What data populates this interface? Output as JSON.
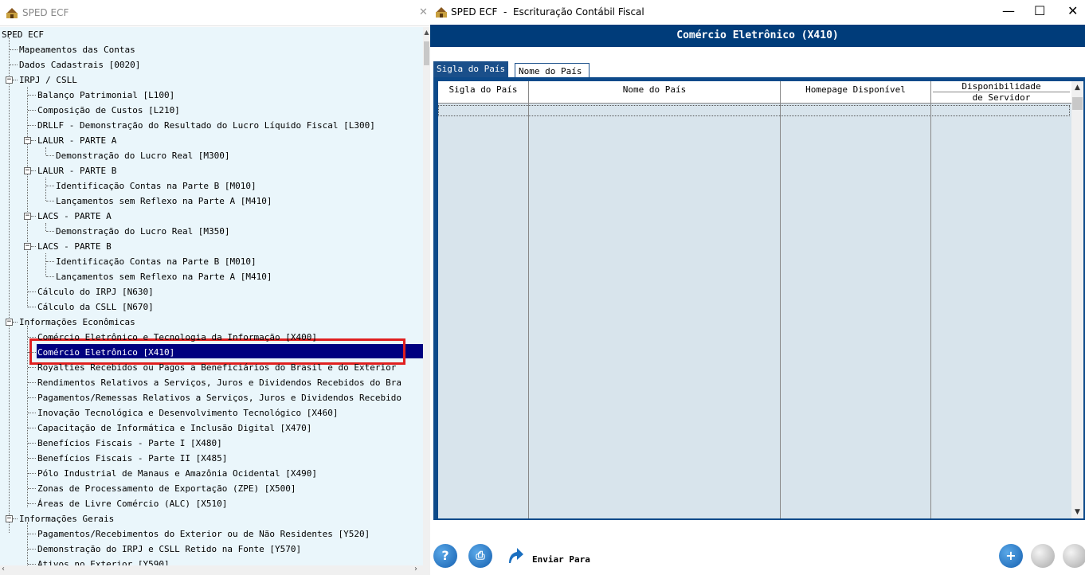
{
  "left_window": {
    "title": "SPED ECF",
    "close_glyph": "✕",
    "tree": {
      "root": "SPED ECF",
      "items": [
        {
          "label": "Mapeamentos das Contas"
        },
        {
          "label": "Dados Cadastrais [0020]"
        },
        {
          "label": "IRPJ / CSLL"
        },
        {
          "label": "Balanço Patrimonial [L100]"
        },
        {
          "label": "Composição de Custos [L210]"
        },
        {
          "label": "DRLLF - Demonstração do Resultado do Lucro Líquido Fiscal [L300]"
        },
        {
          "label": "LALUR - PARTE A"
        },
        {
          "label": "Demonstração do Lucro Real [M300]"
        },
        {
          "label": "LALUR - PARTE B"
        },
        {
          "label": "Identificação Contas na Parte B [M010]"
        },
        {
          "label": "Lançamentos sem Reflexo na Parte A [M410]"
        },
        {
          "label": "LACS - PARTE A"
        },
        {
          "label": "Demonstração do Lucro Real [M350]"
        },
        {
          "label": "LACS - PARTE B"
        },
        {
          "label": "Identificação Contas na Parte B [M010]"
        },
        {
          "label": "Lançamentos sem Reflexo na Parte A [M410]"
        },
        {
          "label": "Cálculo do IRPJ [N630]"
        },
        {
          "label": "Cálculo da CSLL [N670]"
        },
        {
          "label": "Informações Econômicas"
        },
        {
          "label": "Comércio Eletrônico e Tecnologia da Informação [X400]"
        },
        {
          "label": "Comércio Eletrônico [X410]"
        },
        {
          "label": "Royalties Recebidos ou Pagos a Beneficiários do Brasil e do Exterior"
        },
        {
          "label": "Rendimentos Relativos a Serviços, Juros e Dividendos Recebidos do Bra"
        },
        {
          "label": "Pagamentos/Remessas Relativos a Serviços, Juros e Dividendos Recebido"
        },
        {
          "label": "Inovação Tecnológica e Desenvolvimento Tecnológico [X460]"
        },
        {
          "label": "Capacitação de Informática e Inclusão Digital [X470]"
        },
        {
          "label": "Benefícios Fiscais - Parte I [X480]"
        },
        {
          "label": "Benefícios Fiscais - Parte II [X485]"
        },
        {
          "label": "Pólo Industrial de Manaus e Amazônia Ocidental [X490]"
        },
        {
          "label": "Zonas de Processamento de Exportação (ZPE) [X500]"
        },
        {
          "label": "Áreas de Livre Comércio (ALC) [X510]"
        },
        {
          "label": "Informações Gerais"
        },
        {
          "label": "Pagamentos/Recebimentos do Exterior ou de Não Residentes [Y520]"
        },
        {
          "label": "Demonstração do IRPJ e CSLL Retido na Fonte [Y570]"
        },
        {
          "label": "Ativos no Exterior [Y590]"
        }
      ]
    }
  },
  "right_window": {
    "title": "SPED ECF  -  Escrituração Contábil Fiscal",
    "minimize_glyph": "—",
    "maximize_glyph": "☐",
    "close_glyph": "✕",
    "header": "Comércio Eletrônico (X410)",
    "tabs": [
      {
        "label": "Sigla do País",
        "active": true
      },
      {
        "label": "Nome do País",
        "active": false
      }
    ],
    "grid": {
      "columns": [
        "Sigla do País",
        "Nome do País",
        "Homepage Disponível"
      ],
      "last_column_line1": "Disponibilidade",
      "last_column_line2": "de Servidor",
      "rows": []
    },
    "toolbar": {
      "help_glyph": "?",
      "print_glyph": "⎙",
      "send_label": "Enviar Para",
      "add_glyph": "+"
    }
  },
  "colors": {
    "header_bg": "#003c7a",
    "tree_bg": "#eaf6fb",
    "selection": "#000080",
    "highlight_box": "#e02020",
    "grid_bg": "#d8e4ec"
  }
}
